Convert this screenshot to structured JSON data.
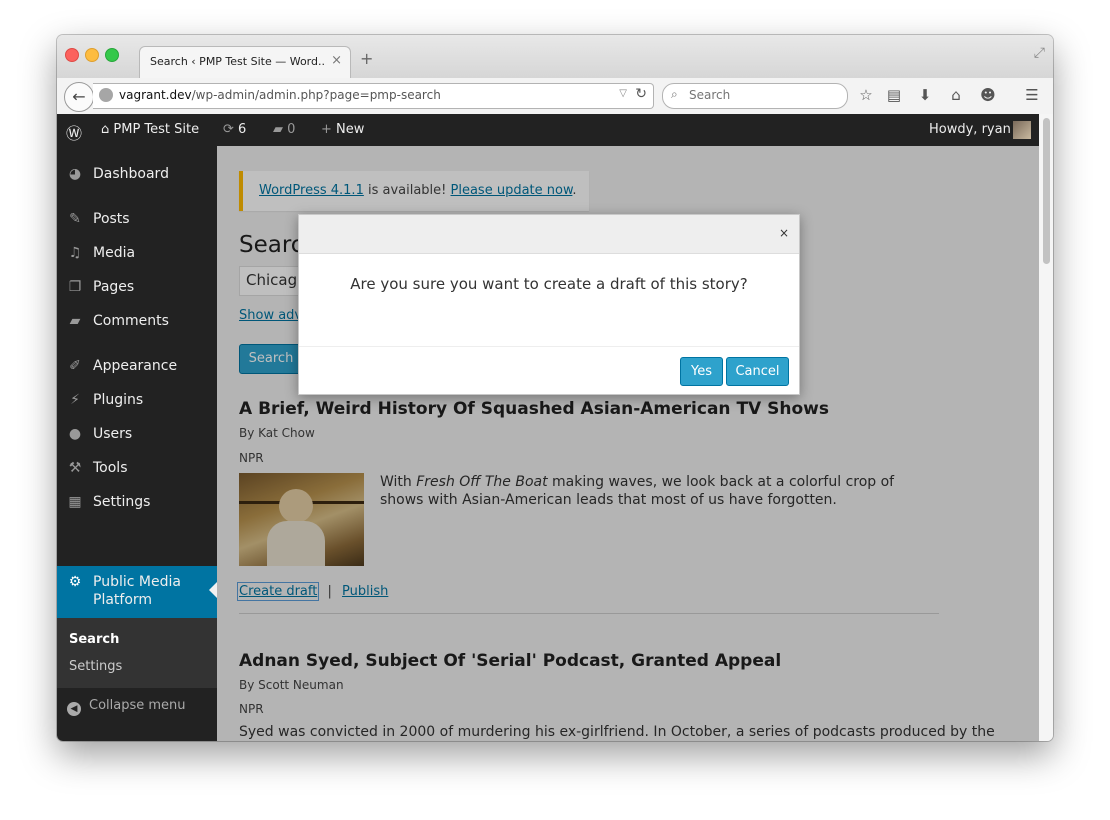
{
  "browser": {
    "tab_title": "Search ‹ PMP Test Site — Word...",
    "tab_close": "×",
    "new_tab": "+",
    "url_host": "vagrant.dev",
    "url_path": "/wp-admin/admin.php?page=pmp-search",
    "search_placeholder": "Search"
  },
  "admin_bar": {
    "site_name": "PMP Test Site",
    "updates_count": "6",
    "comments_count": "0",
    "new_label": "New",
    "greeting": "Howdy, ryan"
  },
  "sidebar": {
    "items": [
      {
        "label": "Dashboard",
        "icon": "dashboard-icon"
      },
      {
        "label": "Posts",
        "icon": "pin-icon"
      },
      {
        "label": "Media",
        "icon": "media-icon"
      },
      {
        "label": "Pages",
        "icon": "pages-icon"
      },
      {
        "label": "Comments",
        "icon": "comment-icon"
      },
      {
        "label": "Appearance",
        "icon": "brush-icon"
      },
      {
        "label": "Plugins",
        "icon": "plug-icon"
      },
      {
        "label": "Users",
        "icon": "user-icon"
      },
      {
        "label": "Tools",
        "icon": "wrench-icon"
      },
      {
        "label": "Settings",
        "icon": "settings-icon"
      }
    ],
    "active_label_1": "Public Media",
    "active_label_2": "Platform",
    "submenu": [
      "Search",
      "Settings"
    ],
    "collapse_label": "Collapse menu"
  },
  "notice": {
    "link1": "WordPress 4.1.1",
    "middle": " is available! ",
    "link2": "Please update now",
    "end": "."
  },
  "page": {
    "heading": "Search",
    "search_value": "Chicago",
    "advanced_link": "Show advanced options",
    "search_button": "Search"
  },
  "stories": [
    {
      "title": "A Brief, Weird History Of Squashed Asian-American TV Shows",
      "byline": "By Kat Chow",
      "source": "NPR",
      "excerpt_pre": "With ",
      "excerpt_em": "Fresh Off The Boat",
      "excerpt_post": " making waves, we look back at a colorful crop of shows with Asian-American leads that most of us have forgotten.",
      "create_draft": "Create draft",
      "separator": "|",
      "publish": "Publish"
    },
    {
      "title": "Adnan Syed, Subject Of 'Serial' Podcast, Granted Appeal",
      "byline": "By Scott Neuman",
      "source": "NPR",
      "excerpt": "Syed was convicted in 2000 of murdering his ex-girlfriend. In October, a series of podcasts produced by the"
    }
  ],
  "modal": {
    "close": "×",
    "message": "Are you sure you want to create a draft of this story?",
    "yes": "Yes",
    "cancel": "Cancel"
  },
  "colors": {
    "wp_blue": "#0074a2",
    "button_blue": "#2ea2cc",
    "admin_dark": "#222222",
    "notice_yellow": "#ffba00"
  }
}
